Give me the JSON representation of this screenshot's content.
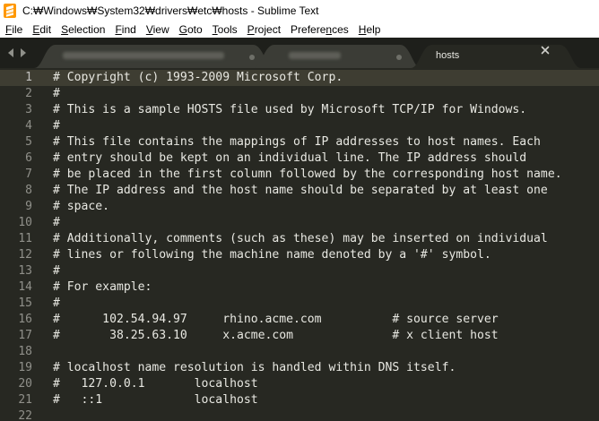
{
  "window": {
    "title": "C:₩Windows₩System32₩drivers₩etc₩hosts - Sublime Text",
    "app_icon": "sublime-text-icon"
  },
  "menu": {
    "items": [
      {
        "id": "file",
        "mnemonic": "F",
        "rest": "ile"
      },
      {
        "id": "edit",
        "mnemonic": "E",
        "rest": "dit"
      },
      {
        "id": "selection",
        "mnemonic": "S",
        "rest": "election"
      },
      {
        "id": "find",
        "mnemonic": "F",
        "rest": "ind",
        "pre": ""
      },
      {
        "id": "view",
        "mnemonic": "V",
        "rest": "iew"
      },
      {
        "id": "goto",
        "mnemonic": "G",
        "rest": "oto"
      },
      {
        "id": "tools",
        "mnemonic": "T",
        "rest": "ools"
      },
      {
        "id": "project",
        "mnemonic": "P",
        "rest": "roject"
      },
      {
        "id": "preferences",
        "pre": "Prefere",
        "mnemonic": "n",
        "rest": "ces"
      },
      {
        "id": "help",
        "mnemonic": "H",
        "rest": "elp"
      }
    ]
  },
  "tabs": {
    "nav_icons": [
      "chevron-left-icon",
      "chevron-right-icon"
    ],
    "items": [
      {
        "label": "",
        "modified": true,
        "active": false,
        "obscured": true
      },
      {
        "label": "",
        "modified": true,
        "active": false,
        "obscured": true
      },
      {
        "label": "hosts",
        "modified": false,
        "active": true,
        "obscured": false
      }
    ],
    "close_icon": "close-icon"
  },
  "editor": {
    "current_line": 1,
    "lines": [
      {
        "n": "1",
        "text": "# Copyright (c) 1993-2009 Microsoft Corp."
      },
      {
        "n": "2",
        "text": "#"
      },
      {
        "n": "3",
        "text": "# This is a sample HOSTS file used by Microsoft TCP/IP for Windows."
      },
      {
        "n": "4",
        "text": "#"
      },
      {
        "n": "5",
        "text": "# This file contains the mappings of IP addresses to host names. Each"
      },
      {
        "n": "6",
        "text": "# entry should be kept on an individual line. The IP address should"
      },
      {
        "n": "7",
        "text": "# be placed in the first column followed by the corresponding host name."
      },
      {
        "n": "8",
        "text": "# The IP address and the host name should be separated by at least one"
      },
      {
        "n": "9",
        "text": "# space."
      },
      {
        "n": "10",
        "text": "#"
      },
      {
        "n": "11",
        "text": "# Additionally, comments (such as these) may be inserted on individual"
      },
      {
        "n": "12",
        "text": "# lines or following the machine name denoted by a '#' symbol."
      },
      {
        "n": "13",
        "text": "#"
      },
      {
        "n": "14",
        "text": "# For example:"
      },
      {
        "n": "15",
        "text": "#"
      },
      {
        "n": "16",
        "text": "#      102.54.94.97     rhino.acme.com          # source server"
      },
      {
        "n": "17",
        "text": "#       38.25.63.10     x.acme.com              # x client host"
      },
      {
        "n": "18",
        "text": ""
      },
      {
        "n": "19",
        "text": "# localhost name resolution is handled within DNS itself."
      },
      {
        "n": "20",
        "text": "#   127.0.0.1       localhost"
      },
      {
        "n": "21",
        "text": "#   ::1             localhost"
      },
      {
        "n": "22",
        "text": ""
      }
    ]
  },
  "colors": {
    "editor_background": "#272822",
    "current_line_highlight": "#3e3d32",
    "gutter_text": "#90908a",
    "foreground": "#e8e8e2",
    "tabbar_background": "#1e1f1b",
    "active_tab": "#272822",
    "inactive_tab": "#3b3c36",
    "app_icon_orange": "#ff9800"
  }
}
